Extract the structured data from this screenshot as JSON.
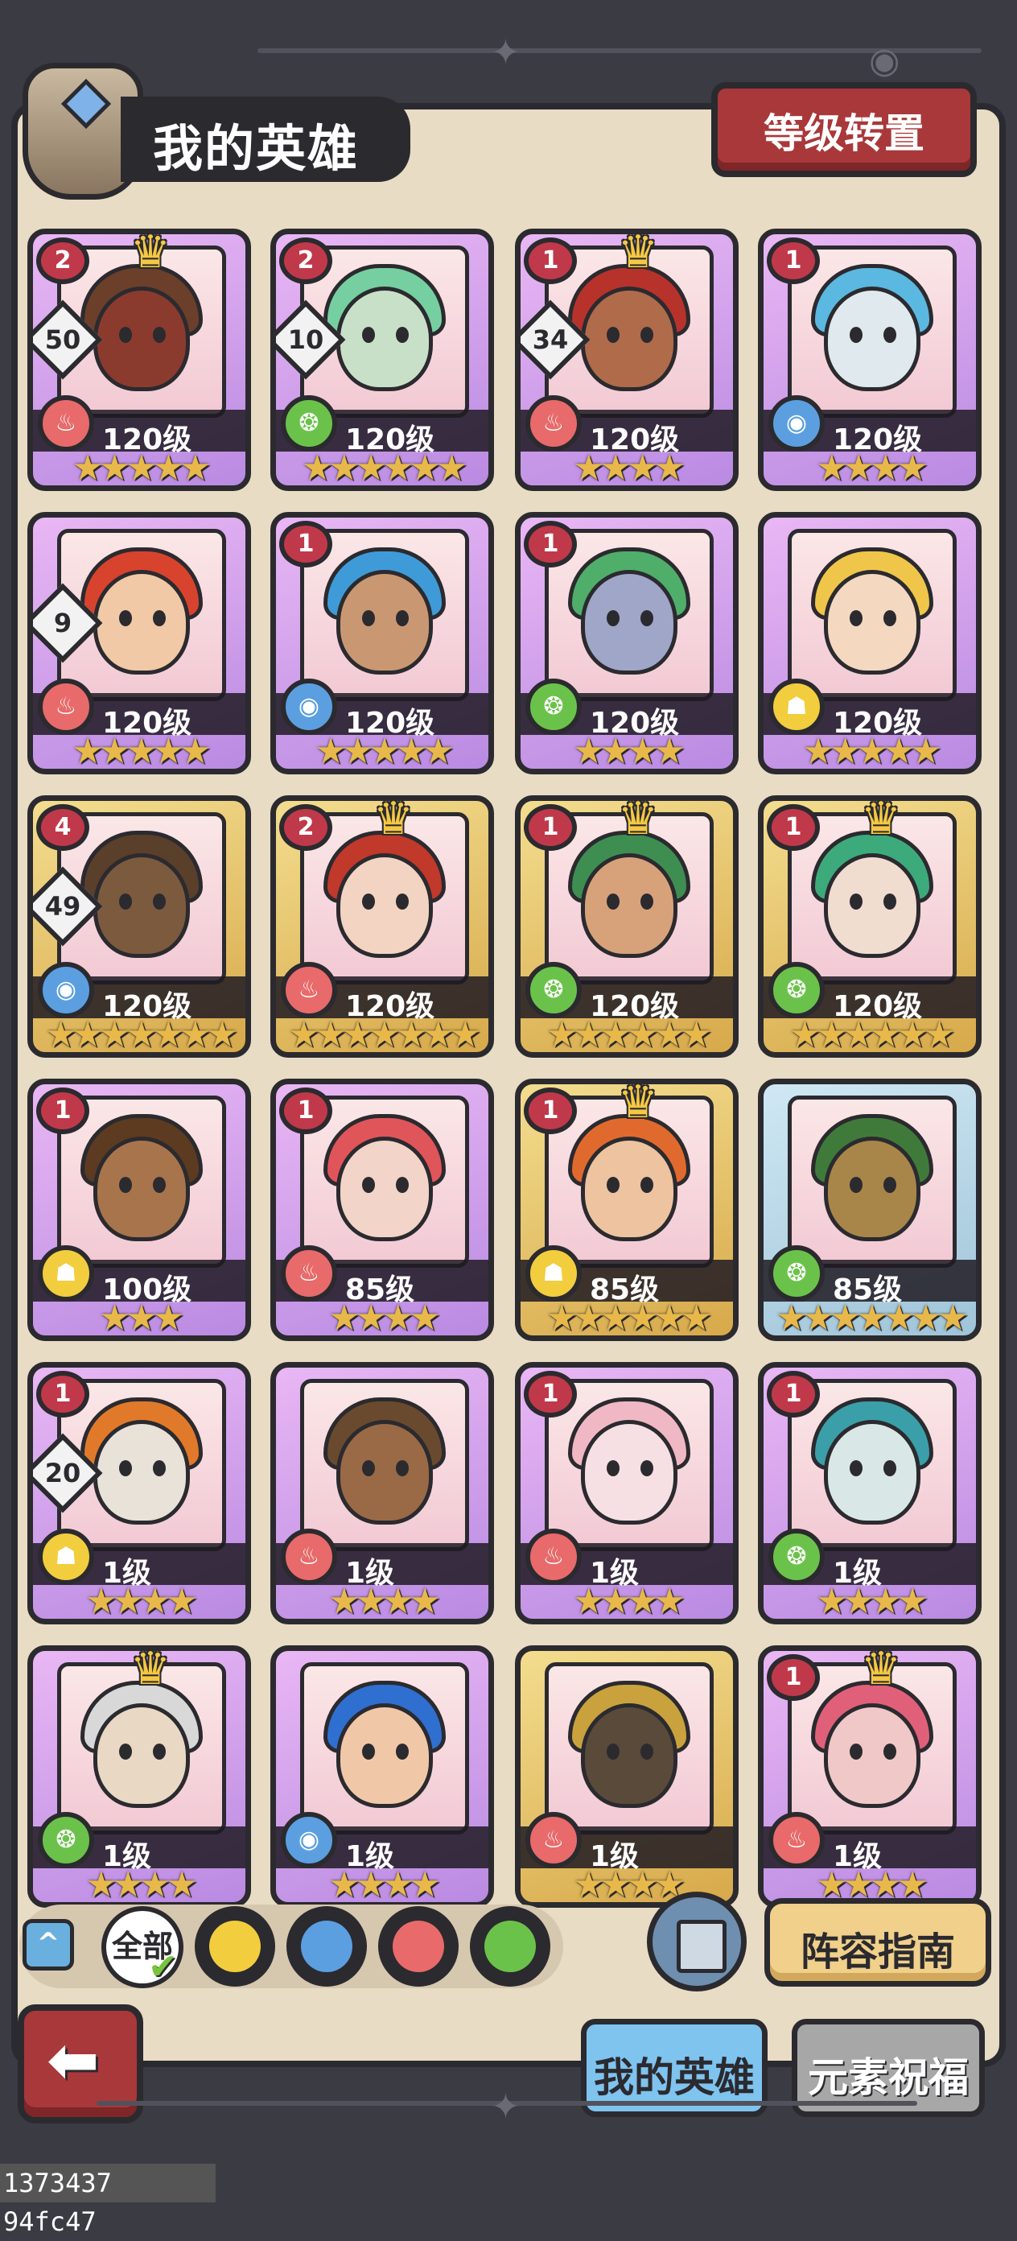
{
  "header": {
    "title": "我的英雄",
    "level_transfer_label": "等级转置"
  },
  "heroes": [
    {
      "level": "120级",
      "element": "fire",
      "stars": "★★★★★",
      "rarity": "purple",
      "rank": "2",
      "count": "50",
      "crown": true,
      "skin": "#8a3b2e",
      "hair": "#6b3f2a"
    },
    {
      "level": "120级",
      "element": "wind",
      "stars": "★★★★★★",
      "rarity": "purple",
      "rank": "2",
      "count": "10",
      "crown": false,
      "skin": "#c9e0c8",
      "hair": "#76cfa0"
    },
    {
      "level": "120级",
      "element": "fire",
      "stars": "★★★★",
      "rarity": "purple",
      "rank": "1",
      "count": "34",
      "crown": true,
      "skin": "#b06b4a",
      "hair": "#b8322c"
    },
    {
      "level": "120级",
      "element": "water",
      "stars": "★★★★",
      "rarity": "purple",
      "rank": "1",
      "count": "",
      "crown": false,
      "skin": "#dfe9ee",
      "hair": "#5bb8e0"
    },
    {
      "level": "120级",
      "element": "fire",
      "stars": "★★★★★",
      "rarity": "purple",
      "rank": "",
      "count": "9",
      "crown": false,
      "skin": "#f1c9a6",
      "hair": "#d8432e"
    },
    {
      "level": "120级",
      "element": "water",
      "stars": "★★★★★",
      "rarity": "purple",
      "rank": "1",
      "count": "",
      "crown": false,
      "skin": "#c99873",
      "hair": "#3f9bd8"
    },
    {
      "level": "120级",
      "element": "wind",
      "stars": "★★★★",
      "rarity": "purple",
      "rank": "1",
      "count": "",
      "crown": false,
      "skin": "#9fa6c8",
      "hair": "#4fae6a"
    },
    {
      "level": "120级",
      "element": "earth",
      "stars": "★★★★★",
      "rarity": "purple",
      "rank": "",
      "count": "",
      "crown": false,
      "skin": "#f4d8c0",
      "hair": "#f0c64a"
    },
    {
      "level": "120级",
      "element": "water",
      "stars": "★★★★★★★",
      "rarity": "gold",
      "rank": "4",
      "count": "49",
      "crown": false,
      "skin": "#7c5a3e",
      "hair": "#5a3f2a"
    },
    {
      "level": "120级",
      "element": "fire",
      "stars": "★★★★★★★",
      "rarity": "gold",
      "rank": "2",
      "count": "",
      "crown": true,
      "skin": "#f3d4c2",
      "hair": "#c0392b"
    },
    {
      "level": "120级",
      "element": "wind",
      "stars": "★★★★★★",
      "rarity": "gold",
      "rank": "1",
      "count": "",
      "crown": true,
      "skin": "#d7a27a",
      "hair": "#3e8e52"
    },
    {
      "level": "120级",
      "element": "wind",
      "stars": "★★★★★★",
      "rarity": "gold",
      "rank": "1",
      "count": "",
      "crown": true,
      "skin": "#f1dcd0",
      "hair": "#3daa7c"
    },
    {
      "level": "100级",
      "element": "earth",
      "stars": "★★★",
      "rarity": "purple",
      "rank": "1",
      "count": "",
      "crown": false,
      "skin": "#a8744c",
      "hair": "#5c3b20"
    },
    {
      "level": "85级",
      "element": "fire",
      "stars": "★★★★",
      "rarity": "purple",
      "rank": "1",
      "count": "",
      "crown": false,
      "skin": "#f3d4c8",
      "hair": "#e0555a"
    },
    {
      "level": "85级",
      "element": "earth",
      "stars": "★★★★★★",
      "rarity": "gold",
      "rank": "1",
      "count": "",
      "crown": true,
      "skin": "#eec3a0",
      "hair": "#e06a2e"
    },
    {
      "level": "85级",
      "element": "wind",
      "stars": "★★★★★★★",
      "rarity": "blue",
      "rank": "",
      "count": "",
      "crown": false,
      "skin": "#a8864a",
      "hair": "#3f7a3a"
    },
    {
      "level": "1级",
      "element": "earth",
      "stars": "★★★★",
      "rarity": "purple",
      "rank": "1",
      "count": "20",
      "crown": false,
      "skin": "#e8e2d8",
      "hair": "#e07a2a"
    },
    {
      "level": "1级",
      "element": "fire",
      "stars": "★★★★",
      "rarity": "purple",
      "rank": "",
      "count": "",
      "crown": false,
      "skin": "#9a6a46",
      "hair": "#6a4a2e"
    },
    {
      "level": "1级",
      "element": "fire",
      "stars": "★★★★",
      "rarity": "purple",
      "rank": "1",
      "count": "",
      "crown": false,
      "skin": "#f6e0e4",
      "hair": "#f0b8c4"
    },
    {
      "level": "1级",
      "element": "wind",
      "stars": "★★★★",
      "rarity": "purple",
      "rank": "1",
      "count": "",
      "crown": false,
      "skin": "#d9e8e6",
      "hair": "#3a9fa8"
    },
    {
      "level": "1级",
      "element": "wind",
      "stars": "★★★★",
      "rarity": "purple",
      "rank": "",
      "count": "",
      "crown": true,
      "skin": "#e8d8c4",
      "hair": "#d8d8d8"
    },
    {
      "level": "1级",
      "element": "water",
      "stars": "★★★★",
      "rarity": "purple",
      "rank": "",
      "count": "",
      "crown": false,
      "skin": "#f0c8a8",
      "hair": "#2f6fd0"
    },
    {
      "level": "1级",
      "element": "fire",
      "stars": "★★★★",
      "rarity": "gold",
      "rank": "",
      "count": "",
      "crown": false,
      "skin": "#5a4a3a",
      "hair": "#c9a23e"
    },
    {
      "level": "1级",
      "element": "fire",
      "stars": "★★★★",
      "rarity": "purple",
      "rank": "1",
      "count": "",
      "crown": true,
      "skin": "#f0c8c8",
      "hair": "#e0607a"
    }
  ],
  "filter": {
    "collapse_icon": "^",
    "all_label": "全部",
    "elements": [
      "earth",
      "water",
      "fire",
      "wind"
    ]
  },
  "colors": {
    "fire": "#e86a6a",
    "water": "#5b9fe0",
    "wind": "#6bc24a",
    "earth": "#f2cd3e"
  },
  "buttons": {
    "lineup_guide": "阵容指南"
  },
  "tabs": {
    "my_heroes": "我的英雄",
    "element_blessing": "元素祝福"
  },
  "footer": {
    "id_text": "1373437 94fc47"
  }
}
